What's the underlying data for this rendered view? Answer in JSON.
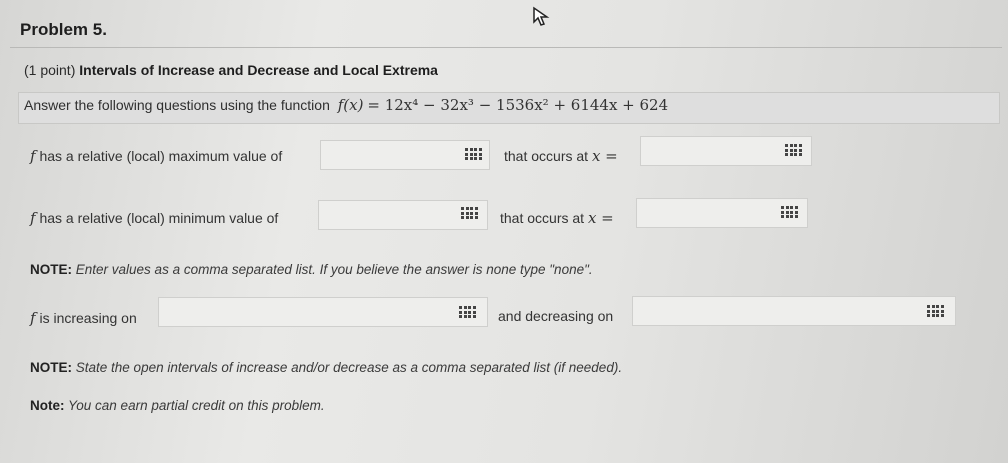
{
  "problem": {
    "title": "Problem 5."
  },
  "heading": {
    "points": "(1 point)",
    "title": "Intervals of Increase and Decrease and Local Extrema"
  },
  "question": {
    "prefix": "Answer the following questions using the function",
    "function_lhs": "f(x)",
    "function_rhs": "= 12x⁴ − 32x³ − 1536x² + 6144x + 624"
  },
  "max_row": {
    "label": "has a relative (local) maximum value of",
    "occurs_label": "that occurs at",
    "var": "x ="
  },
  "min_row": {
    "label": "has a relative (local) minimum value of",
    "occurs_label": "that occurs at",
    "var": "x ="
  },
  "note1": {
    "label": "NOTE:",
    "text": "Enter values as a comma separated list. If you believe the answer is none type \"none\"."
  },
  "inc_row": {
    "label": "is increasing on",
    "dec_label": "and decreasing on"
  },
  "note2": {
    "label": "NOTE:",
    "text": "State the open intervals of increase and/or decrease as a comma separated list (if needed)."
  },
  "note3": {
    "label": "Note:",
    "text": "You can earn partial credit on this problem."
  },
  "f_symbol": "f",
  "icons": {
    "cursor": "mouse-cursor-icon",
    "grid": "keypad-grid-icon"
  }
}
